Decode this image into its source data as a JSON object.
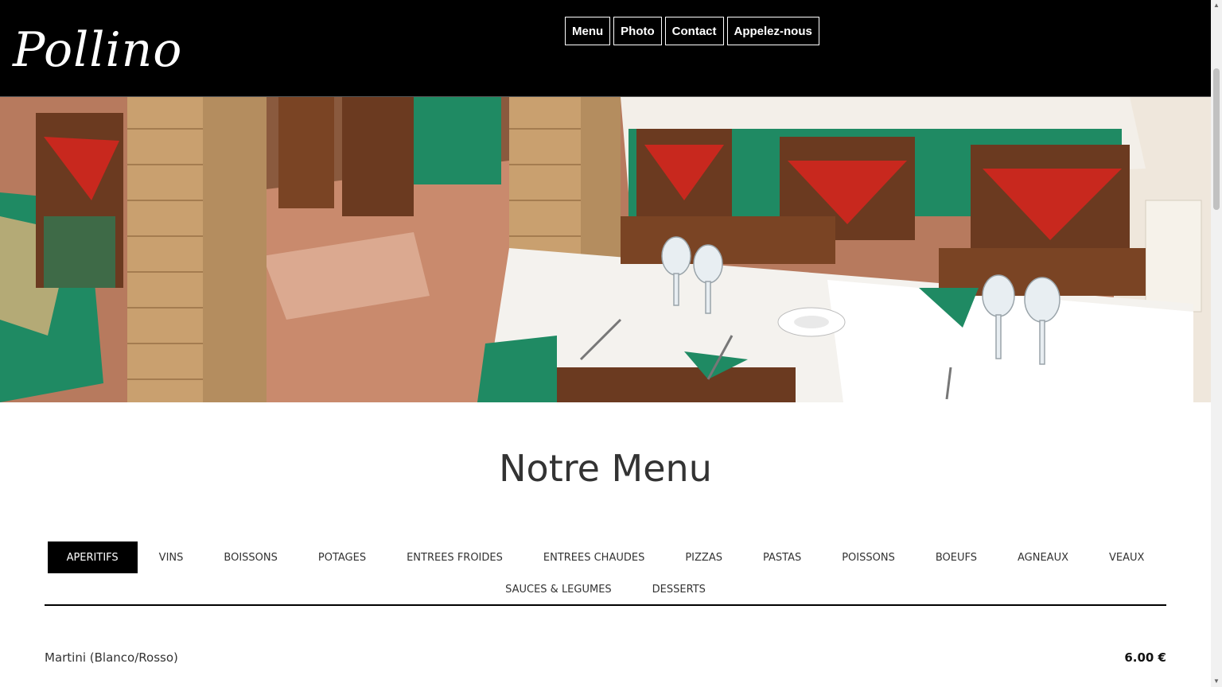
{
  "header": {
    "logo": "Pollino",
    "nav": [
      "Menu",
      "Photo",
      "Contact",
      "Appelez-nous"
    ]
  },
  "hero": {
    "icon": "restaurant-interior-photo"
  },
  "menu": {
    "title": "Notre Menu",
    "tabs_row1": [
      "APERITIFS",
      "VINS",
      "BOISSONS",
      "POTAGES",
      "ENTREES FROIDES",
      "ENTREES CHAUDES",
      "PIZZAS",
      "PASTAS",
      "POISSONS",
      "BOEUFS",
      "AGNEAUX",
      "VEAUX"
    ],
    "tabs_row2": [
      "SAUCES & LEGUMES",
      "DESSERTS"
    ],
    "active_tab": "APERITIFS",
    "items": [
      {
        "name": "Martini (Blanco/Rosso)",
        "price": "6.00 €"
      }
    ]
  },
  "colors": {
    "header_bg": "#000000",
    "active_tab_bg": "#000000",
    "tablecloth_green": "#1f8a63",
    "napkin_red": "#c8281e"
  }
}
